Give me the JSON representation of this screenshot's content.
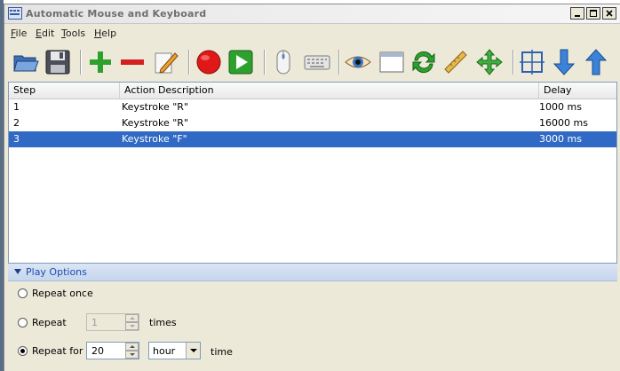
{
  "window": {
    "title": "Automatic Mouse and Keyboard"
  },
  "menu": [
    "File",
    "Edit",
    "Tools",
    "Help"
  ],
  "toolbar": [
    {
      "name": "open-icon"
    },
    {
      "name": "save-icon"
    },
    {
      "name": "add-icon"
    },
    {
      "name": "remove-icon"
    },
    {
      "name": "edit-icon"
    },
    {
      "name": "record-icon"
    },
    {
      "name": "play-icon"
    },
    {
      "name": "mouse-icon"
    },
    {
      "name": "keyboard-icon"
    },
    {
      "name": "eye-icon"
    },
    {
      "name": "window-icon"
    },
    {
      "name": "refresh-icon"
    },
    {
      "name": "ruler-icon"
    },
    {
      "name": "move-icon"
    },
    {
      "name": "select-region-icon"
    },
    {
      "name": "arrow-down-icon"
    },
    {
      "name": "arrow-up-icon"
    }
  ],
  "table": {
    "columns": [
      "Step",
      "Action Description",
      "Delay"
    ],
    "rows": [
      {
        "step": "1",
        "action": "Keystroke \"R\"",
        "delay": "1000 ms"
      },
      {
        "step": "2",
        "action": "Keystroke \"R\"",
        "delay": "16000 ms"
      },
      {
        "step": "3",
        "action": "Keystroke \"F\"",
        "delay": "3000 ms"
      }
    ],
    "selected_row": 3
  },
  "play_options": {
    "title": "Play Options",
    "repeat_once_label": "Repeat once",
    "repeat_label": "Repeat",
    "repeat_count": "1",
    "times_label": "times",
    "repeat_for_label": "Repeat for",
    "repeat_for_value": "20",
    "unit_value": "hour",
    "time_label": "time",
    "selected_option": "repeat_for"
  }
}
